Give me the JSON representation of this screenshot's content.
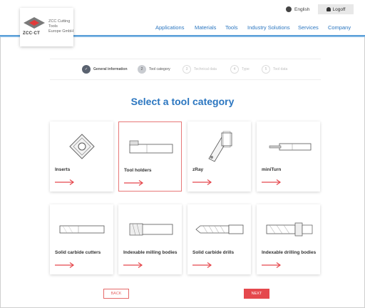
{
  "header": {
    "logo_letters": "ZCC·CT",
    "company_line1": "ZCC Cutting Tools",
    "company_line2": "Europe GmbH",
    "language": "English",
    "logoff": "Logoff",
    "nav": [
      "Applications",
      "Materials",
      "Tools",
      "Industry Solutions",
      "Services",
      "Company"
    ]
  },
  "steps": [
    {
      "num": "✓",
      "label": "General information",
      "state": "done"
    },
    {
      "num": "2",
      "label": "Tool category",
      "state": "active"
    },
    {
      "num": "3",
      "label": "Technical data",
      "state": "todo"
    },
    {
      "num": "4",
      "label": "Type",
      "state": "todo"
    },
    {
      "num": "5",
      "label": "Tool data",
      "state": "todo"
    }
  ],
  "title": "Select a tool category",
  "cards": [
    {
      "label": "Inserts",
      "icon": "insert-icon",
      "selected": false
    },
    {
      "label": "Tool holders",
      "icon": "tool-holder-icon",
      "selected": true
    },
    {
      "label": "zRay",
      "icon": "zray-icon",
      "selected": false
    },
    {
      "label": "miniTurn",
      "icon": "miniturn-icon",
      "selected": false
    },
    {
      "label": "Solid carbide cutters",
      "icon": "carbide-cutter-icon",
      "selected": false
    },
    {
      "label": "Indexable milling bodies",
      "icon": "milling-body-icon",
      "selected": false
    },
    {
      "label": "Solid carbide drills",
      "icon": "carbide-drill-icon",
      "selected": false
    },
    {
      "label": "Indexable drilling bodies",
      "icon": "drilling-body-icon",
      "selected": false
    }
  ],
  "buttons": {
    "back": "BACK",
    "next": "NEXT"
  },
  "colors": {
    "accent_blue": "#2b76c0",
    "accent_red": "#e5484d"
  }
}
